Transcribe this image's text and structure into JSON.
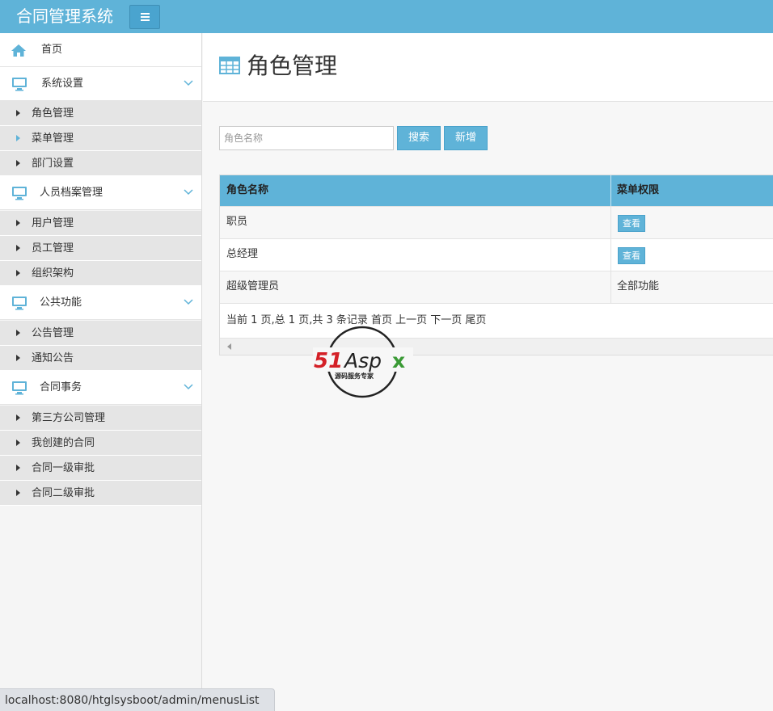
{
  "app": {
    "title": "合同管理系统",
    "accent_color": "#5fb3d8"
  },
  "sidebar": {
    "home": {
      "label": "首页",
      "icon": "home-icon"
    },
    "groups": [
      {
        "label": "系统设置",
        "icon": "monitor-icon",
        "items": [
          "角色管理",
          "菜单管理",
          "部门设置"
        ]
      },
      {
        "label": "人员档案管理",
        "icon": "monitor-icon",
        "items": [
          "用户管理",
          "员工管理",
          "组织架构"
        ]
      },
      {
        "label": "公共功能",
        "icon": "monitor-icon",
        "items": [
          "公告管理",
          "通知公告"
        ]
      },
      {
        "label": "合同事务",
        "icon": "monitor-icon",
        "items": [
          "第三方公司管理",
          "我创建的合同",
          "合同一级审批",
          "合同二级审批"
        ]
      }
    ]
  },
  "page": {
    "title": "角色管理",
    "title_icon": "table-icon"
  },
  "search": {
    "placeholder": "角色名称",
    "value": "",
    "search_label": "搜索",
    "add_label": "新增"
  },
  "table": {
    "columns": [
      "角色名称",
      "菜单权限"
    ],
    "rows": [
      {
        "name": "职员",
        "permission": "查看",
        "permission_is_button": true
      },
      {
        "name": "总经理",
        "permission": "查看",
        "permission_is_button": true
      },
      {
        "name": "超级管理员",
        "permission": "全部功能",
        "permission_is_button": false
      }
    ],
    "pager_text": "当前 1 页,总 1 页,共 3 条记录 首页 上一页 下一页 尾页"
  },
  "watermark": {
    "brand": "51Aspx",
    "tagline": "源码服务专家"
  },
  "statusbar": {
    "url": "localhost:8080/htglsysboot/admin/menusList"
  }
}
